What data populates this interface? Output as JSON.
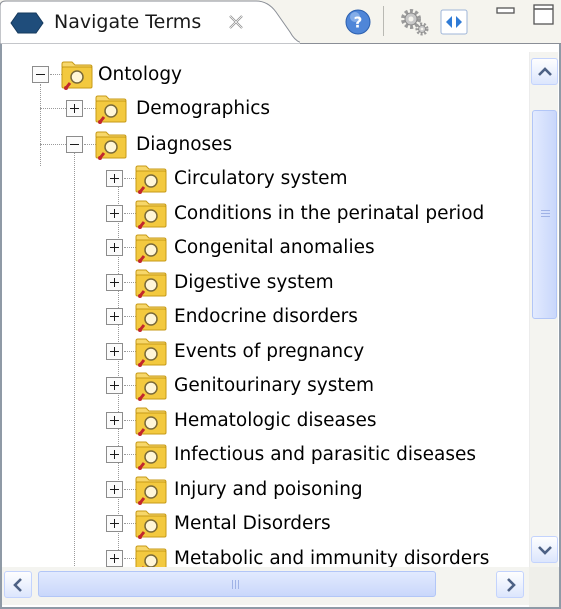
{
  "tab": {
    "title": "Navigate Terms",
    "icon": "hexagon-icon",
    "close_icon": "close-icon"
  },
  "toolbar": {
    "buttons": [
      {
        "name": "help-button",
        "icon": "help-icon"
      },
      {
        "name": "settings-button",
        "icon": "gear-icon"
      },
      {
        "name": "link-button",
        "icon": "arrows-icon"
      },
      {
        "name": "minimize-button",
        "icon": "minimize-icon"
      },
      {
        "name": "maximize-button",
        "icon": "maximize-icon"
      }
    ]
  },
  "tree": {
    "root": {
      "label": "Ontology",
      "expanded": true
    },
    "level1": [
      {
        "label": "Demographics",
        "expanded": false
      },
      {
        "label": "Diagnoses",
        "expanded": true
      }
    ],
    "diagnoses_children": [
      "Circulatory system",
      "Conditions in the perinatal period",
      "Congenital anomalies",
      "Digestive system",
      "Endocrine disorders",
      "Events of pregnancy",
      "Genitourinary system",
      "Hematologic diseases",
      "Infectious and parasitic diseases",
      "Injury and poisoning",
      "Mental Disorders",
      "Metabolic and immunity disorders"
    ]
  },
  "colors": {
    "folder_yellow": "#f3c93f",
    "folder_edge": "#c79a17",
    "scroll_blue": "#c9d7fb",
    "tab_icon": "#1f4d7b"
  },
  "scrollbars": {
    "vertical": {
      "position_fraction": 0.0,
      "thumb_fraction": 0.45
    },
    "horizontal": {
      "position_fraction": 0.0,
      "thumb_fraction": 0.88
    }
  }
}
